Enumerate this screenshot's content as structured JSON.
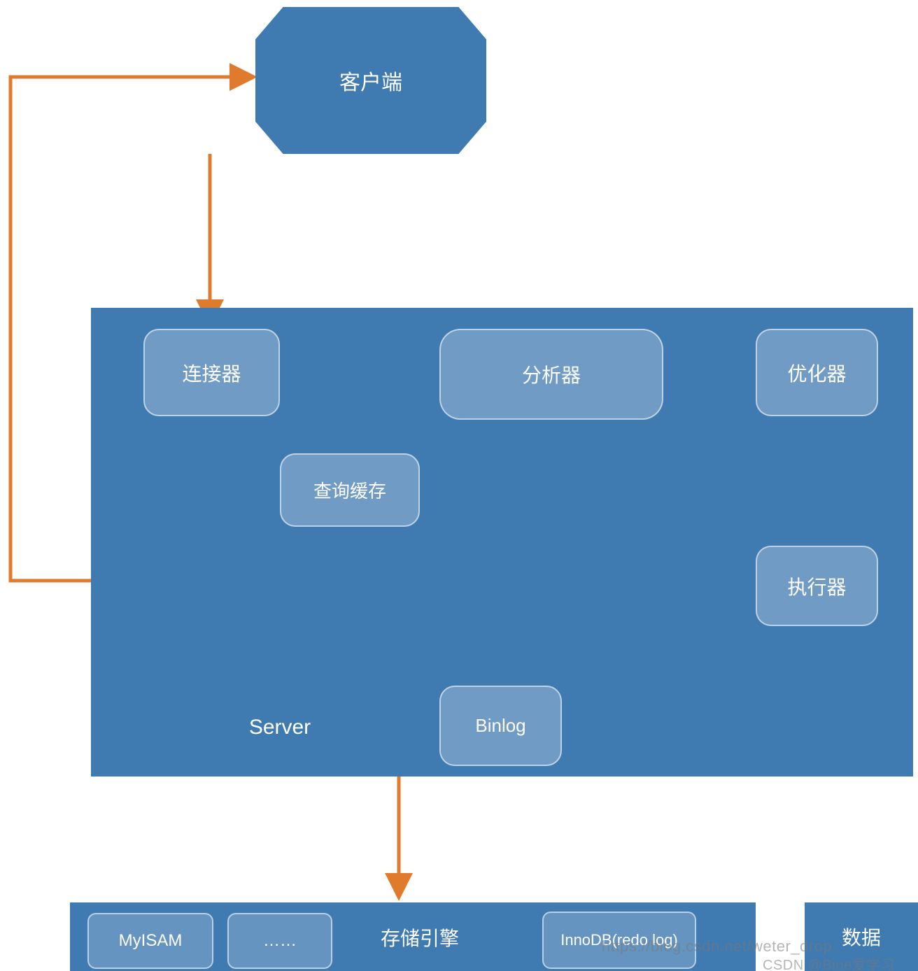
{
  "colors": {
    "block": "#3f7ab1",
    "arrow": "#e07b2e",
    "storageArrow": "#ffffff"
  },
  "nodes": {
    "client": "客户端",
    "server_label": "Server",
    "connector": "连接器",
    "analyzer": "分析器",
    "optimizer": "优化器",
    "query_cache": "查询缓存",
    "executor": "执行器",
    "binlog": "Binlog",
    "storage_label": "存储引擎",
    "myisam": "MyISAM",
    "dots": "……",
    "innodb": "InnoDB(redo log)",
    "data": "数据"
  },
  "watermark": {
    "url": "https://blog.csdn.net/weter_drop",
    "credit": "CSDN @Bine爱学习"
  }
}
